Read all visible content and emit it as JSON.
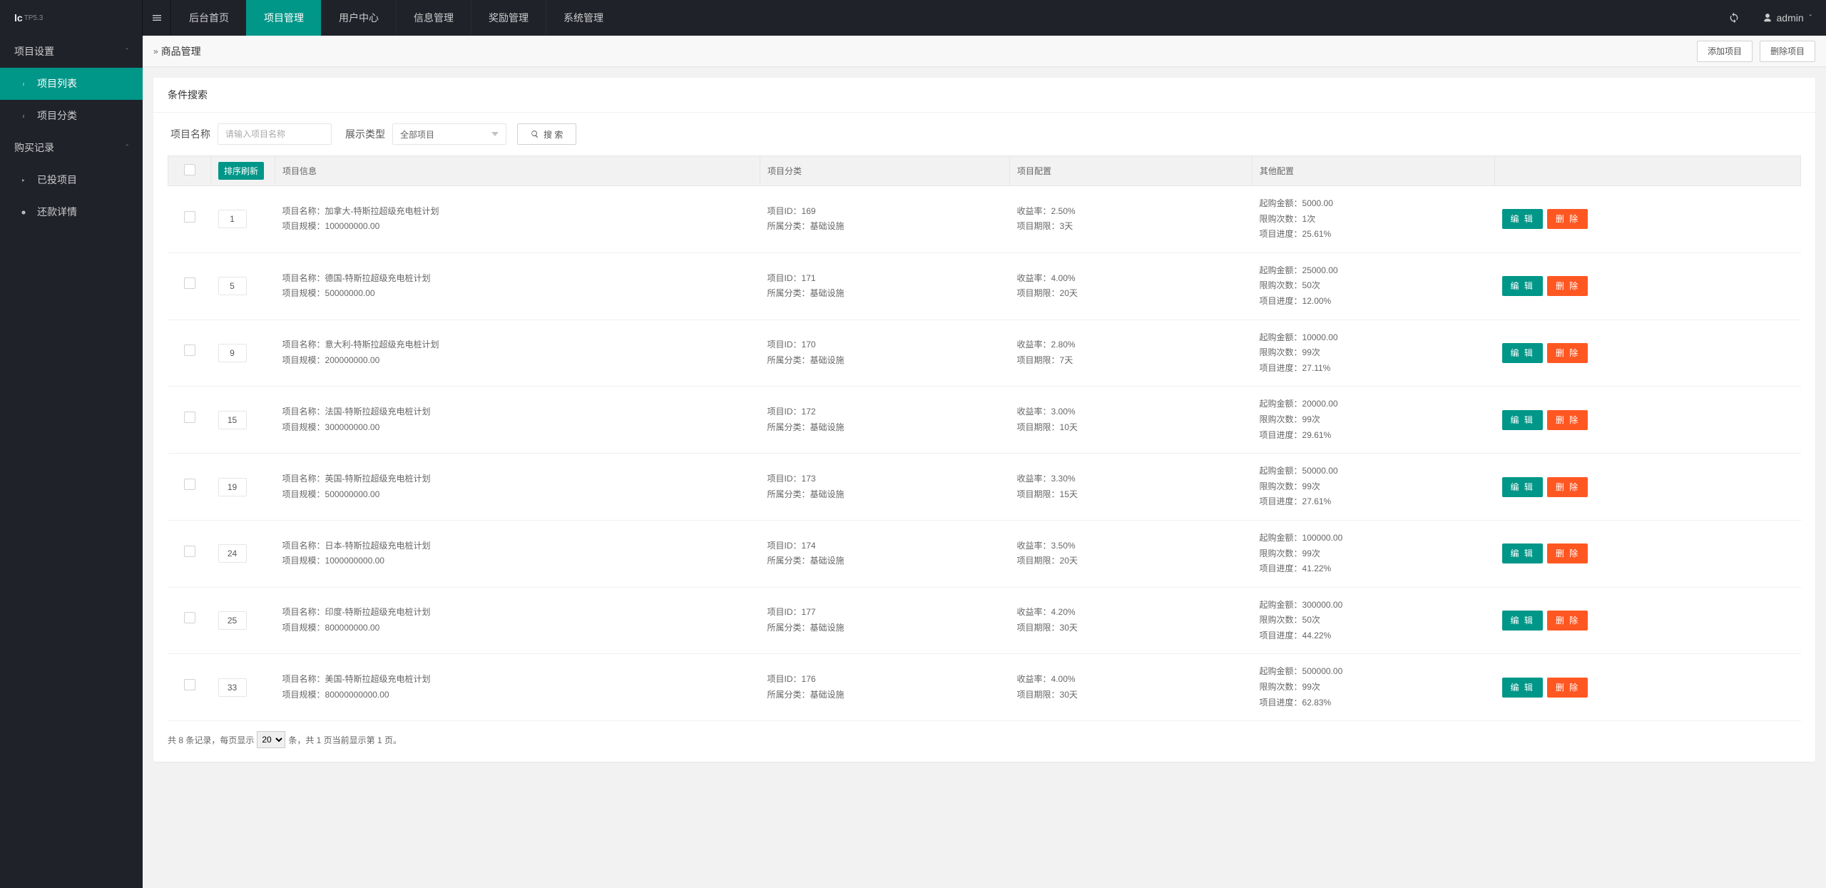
{
  "logo": {
    "main": "lc",
    "sup": "TP5.3"
  },
  "topnav": [
    {
      "label": "后台首页",
      "active": false
    },
    {
      "label": "项目管理",
      "active": true
    },
    {
      "label": "用户中心",
      "active": false
    },
    {
      "label": "信息管理",
      "active": false
    },
    {
      "label": "奖励管理",
      "active": false
    },
    {
      "label": "系统管理",
      "active": false
    }
  ],
  "top_right": {
    "user": "admin"
  },
  "sidebar": [
    {
      "type": "group",
      "label": "项目设置"
    },
    {
      "type": "item",
      "label": "项目列表",
      "icon": "link",
      "active": true
    },
    {
      "type": "item",
      "label": "项目分类",
      "icon": "link",
      "active": false
    },
    {
      "type": "group",
      "label": "购买记录"
    },
    {
      "type": "item",
      "label": "已投项目",
      "icon": "flag",
      "active": false
    },
    {
      "type": "item",
      "label": "还款详情",
      "icon": "info",
      "active": false
    }
  ],
  "breadcrumb": {
    "title": "商品管理"
  },
  "top_buttons": {
    "add": "添加项目",
    "del": "删除项目"
  },
  "search_card": {
    "title": "条件搜索",
    "name_label": "项目名称",
    "name_placeholder": "请输入项目名称",
    "type_label": "展示类型",
    "type_value": "全部项目",
    "btn": "搜 索"
  },
  "table": {
    "headers": {
      "sort_refresh": "排序刷新",
      "info": "项目信息",
      "cat": "项目分类",
      "conf": "项目配置",
      "other": "其他配置"
    },
    "labels": {
      "name": "项目名称：",
      "scale": "项目规模：",
      "pid": "项目ID：",
      "belong": "所属分类：",
      "rate": "收益率：",
      "period": "项目期限：",
      "start": "起购金额：",
      "limit": "限购次数：",
      "progress": "项目进度："
    },
    "edit": "编 辑",
    "del": "删 除",
    "rows": [
      {
        "sort": "1",
        "name": "加拿大-特斯拉超级充电桩计划",
        "scale": "100000000.00",
        "pid": "169",
        "belong": "基础设施",
        "rate": "2.50%",
        "period": "3天",
        "start": "5000.00",
        "limit": "1次",
        "progress": "25.61%"
      },
      {
        "sort": "5",
        "name": "德国-特斯拉超级充电桩计划",
        "scale": "50000000.00",
        "pid": "171",
        "belong": "基础设施",
        "rate": "4.00%",
        "period": "20天",
        "start": "25000.00",
        "limit": "50次",
        "progress": "12.00%"
      },
      {
        "sort": "9",
        "name": "意大利-特斯拉超级充电桩计划",
        "scale": "200000000.00",
        "pid": "170",
        "belong": "基础设施",
        "rate": "2.80%",
        "period": "7天",
        "start": "10000.00",
        "limit": "99次",
        "progress": "27.11%"
      },
      {
        "sort": "15",
        "name": "法国-特斯拉超级充电桩计划",
        "scale": "300000000.00",
        "pid": "172",
        "belong": "基础设施",
        "rate": "3.00%",
        "period": "10天",
        "start": "20000.00",
        "limit": "99次",
        "progress": "29.61%"
      },
      {
        "sort": "19",
        "name": "英国-特斯拉超级充电桩计划",
        "scale": "500000000.00",
        "pid": "173",
        "belong": "基础设施",
        "rate": "3.30%",
        "period": "15天",
        "start": "50000.00",
        "limit": "99次",
        "progress": "27.61%"
      },
      {
        "sort": "24",
        "name": "日本-特斯拉超级充电桩计划",
        "scale": "1000000000.00",
        "pid": "174",
        "belong": "基础设施",
        "rate": "3.50%",
        "period": "20天",
        "start": "100000.00",
        "limit": "99次",
        "progress": "41.22%"
      },
      {
        "sort": "25",
        "name": "印度-特斯拉超级充电桩计划",
        "scale": "800000000.00",
        "pid": "177",
        "belong": "基础设施",
        "rate": "4.20%",
        "period": "30天",
        "start": "300000.00",
        "limit": "50次",
        "progress": "44.22%"
      },
      {
        "sort": "33",
        "name": "美国-特斯拉超级充电桩计划",
        "scale": "80000000000.00",
        "pid": "176",
        "belong": "基础设施",
        "rate": "4.00%",
        "period": "30天",
        "start": "500000.00",
        "limit": "99次",
        "progress": "62.83%"
      }
    ]
  },
  "pagination": {
    "prefix": "共 8 条记录，每页显示 ",
    "per_page_value": "20",
    "suffix": " 条，共 1 页当前显示第 1 页。"
  }
}
